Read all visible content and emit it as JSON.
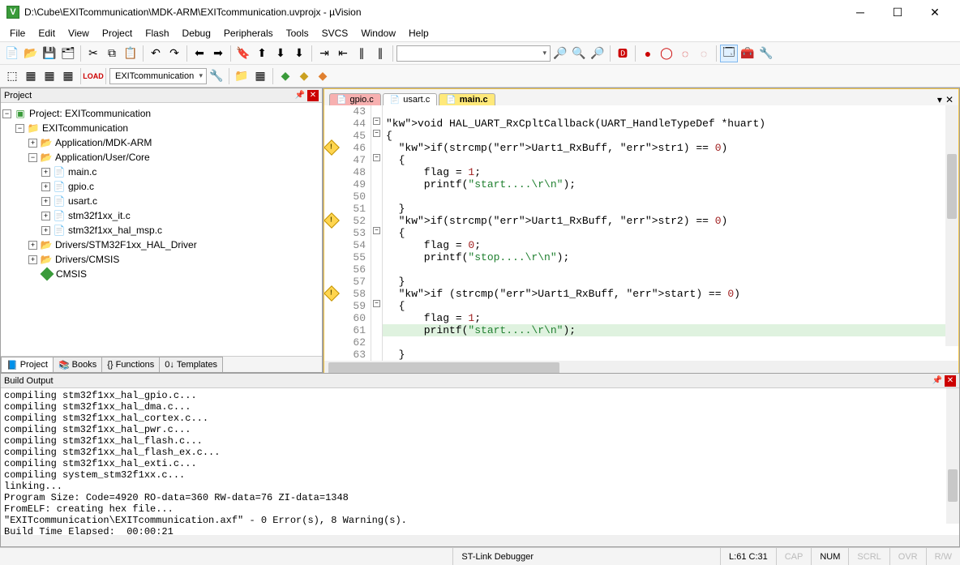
{
  "window": {
    "title": "D:\\Cube\\EXITcommunication\\MDK-ARM\\EXITcommunication.uvprojx - µVision",
    "logo": "V"
  },
  "menu": [
    "File",
    "Edit",
    "View",
    "Project",
    "Flash",
    "Debug",
    "Peripherals",
    "Tools",
    "SVCS",
    "Window",
    "Help"
  ],
  "targetCombo": "EXITcommunication",
  "projectPanel": {
    "title": "Project"
  },
  "tree": {
    "root": "Project: EXITcommunication",
    "target": "EXITcommunication",
    "groups": [
      {
        "name": "Application/MDK-ARM",
        "expanded": false
      },
      {
        "name": "Application/User/Core",
        "expanded": true,
        "files": [
          "main.c",
          "gpio.c",
          "usart.c",
          "stm32f1xx_it.c",
          "stm32f1xx_hal_msp.c"
        ]
      },
      {
        "name": "Drivers/STM32F1xx_HAL_Driver",
        "expanded": false
      },
      {
        "name": "Drivers/CMSIS",
        "expanded": false
      }
    ],
    "cmsis": "CMSIS"
  },
  "bottomTabs": [
    "Project",
    "Books",
    "Functions",
    "Templates"
  ],
  "editorTabs": [
    {
      "label": "gpio.c",
      "cls": "red"
    },
    {
      "label": "usart.c",
      "cls": "white"
    },
    {
      "label": "main.c",
      "cls": "yellow"
    }
  ],
  "code": {
    "startLine": 43,
    "warnLines": [
      46,
      52,
      58
    ],
    "foldOpenLines": [
      45,
      47,
      53,
      59
    ],
    "highlightLine": 61,
    "lines": [
      "",
      "void HAL_UART_RxCpltCallback(UART_HandleTypeDef *huart)",
      "{",
      "  if(strcmp(Uart1_RxBuff, str1) == 0)",
      "  {",
      "      flag = 1;",
      "      printf(\"start....\\r\\n\");",
      "",
      "  }",
      "  if(strcmp(Uart1_RxBuff, str2) == 0)",
      "  {",
      "      flag = 0;",
      "      printf(\"stop....\\r\\n\");",
      "",
      "  }",
      "  if (strcmp(Uart1_RxBuff, start) == 0)",
      "  {",
      "      flag = 1;",
      "      printf(\"start....\\r\\n\");",
      "",
      "  }"
    ]
  },
  "buildPanel": {
    "title": "Build Output"
  },
  "buildLines": [
    "compiling stm32f1xx_hal_gpio.c...",
    "compiling stm32f1xx_hal_dma.c...",
    "compiling stm32f1xx_hal_cortex.c...",
    "compiling stm32f1xx_hal_pwr.c...",
    "compiling stm32f1xx_hal_flash.c...",
    "compiling stm32f1xx_hal_flash_ex.c...",
    "compiling stm32f1xx_hal_exti.c...",
    "compiling system_stm32f1xx.c...",
    "linking...",
    "Program Size: Code=4920 RO-data=360 RW-data=76 ZI-data=1348",
    "FromELF: creating hex file...",
    "\"EXITcommunication\\EXITcommunication.axf\" - 0 Error(s), 8 Warning(s).",
    "Build Time Elapsed:  00:00:21"
  ],
  "status": {
    "debugger": "ST-Link Debugger",
    "pos": "L:61 C:31",
    "cap": "CAP",
    "num": "NUM",
    "scrl": "SCRL",
    "ovr": "OVR",
    "rw": "R/W"
  }
}
